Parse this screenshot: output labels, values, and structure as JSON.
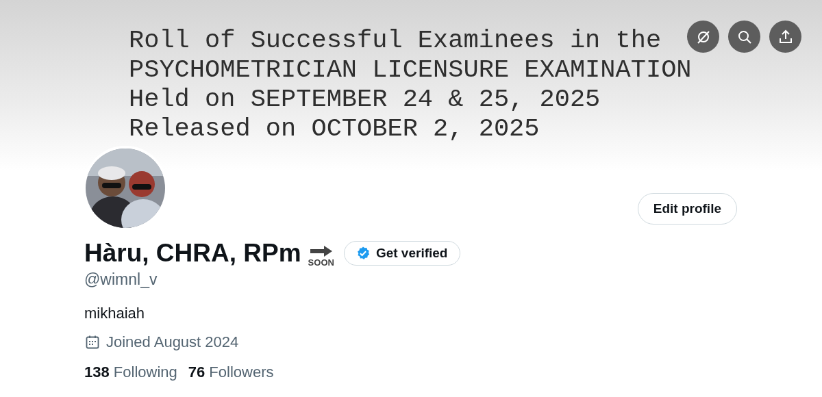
{
  "banner": {
    "lines": [
      "Roll of Successful Examinees in the",
      "PSYCHOMETRICIAN LICENSURE EXAMINATION",
      "Held on SEPTEMBER 24 & 25, 2025",
      "Released on OCTOBER 2, 2025"
    ]
  },
  "header_buttons": [
    {
      "kind": "grok"
    },
    {
      "kind": "search"
    },
    {
      "kind": "share"
    }
  ],
  "edit_button": "Edit profile",
  "profile": {
    "name": "Hàru, CHRA, RPm",
    "name_badge": "SOON",
    "verify_button": "Get verified",
    "handle": "@wimnl_v",
    "bio": "mikhaiah",
    "joined": "Joined August 2024"
  },
  "stats": [
    {
      "count": "138",
      "label": "Following"
    },
    {
      "count": "76",
      "label": "Followers"
    }
  ]
}
